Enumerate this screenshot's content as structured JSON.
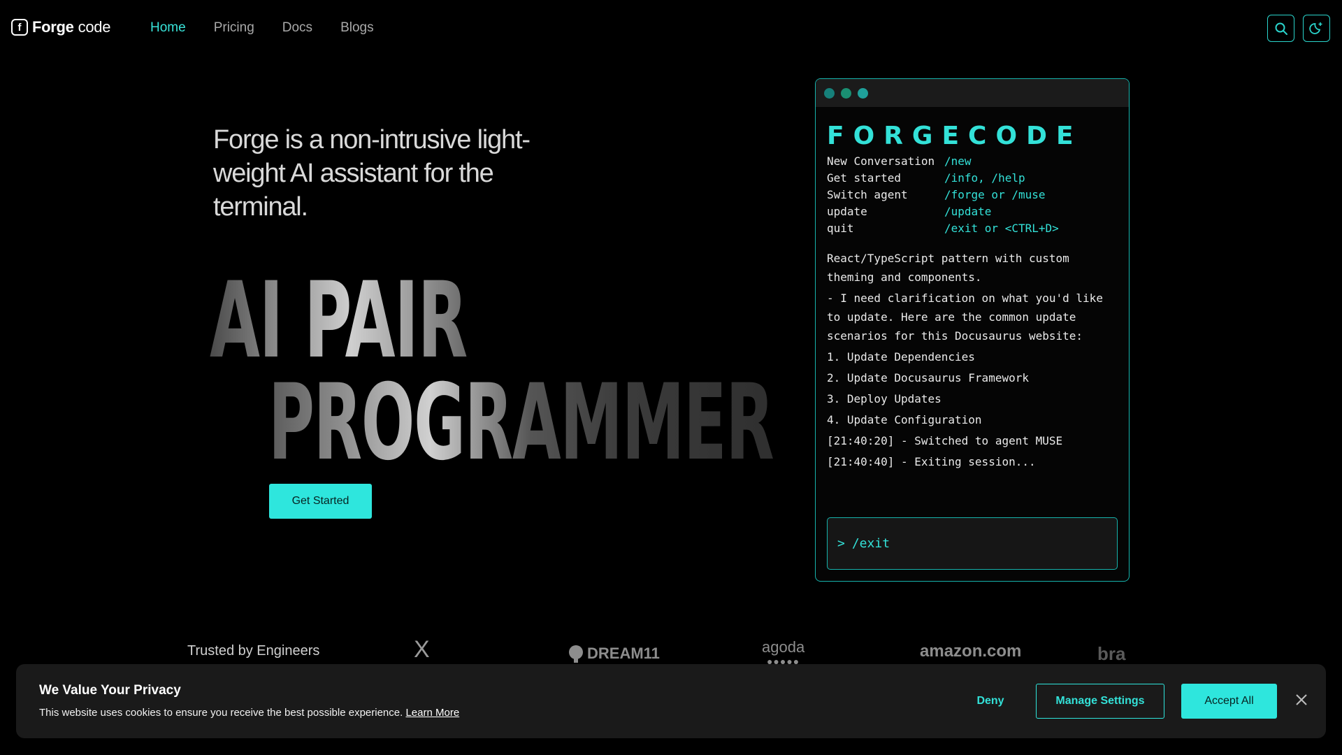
{
  "colors": {
    "accent": "#2ee6dd",
    "background": "#000000",
    "panel": "#1a1a1a"
  },
  "nav": {
    "logo_brand": "Forge",
    "logo_sub": "code",
    "links": [
      "Home",
      "Pricing",
      "Docs",
      "Blogs"
    ],
    "active": "Home",
    "icons": [
      "search-icon",
      "theme-toggle-icon"
    ]
  },
  "hero": {
    "tagline": "Forge is a non-intrusive light-weight AI assistant for the terminal.",
    "headline_line1": "AI PAIR",
    "headline_line2": "PROGRAMMER",
    "cta": "Get Started"
  },
  "terminal": {
    "title": "FORGECODE",
    "commands": [
      {
        "name": "New Conversation",
        "value": "/new"
      },
      {
        "name": "Get started",
        "value": "/info, /help"
      },
      {
        "name": "Switch agent",
        "value": "/forge or /muse"
      },
      {
        "name": "update",
        "value": "/update"
      },
      {
        "name": "quit",
        "value": "/exit or <CTRL+D>"
      }
    ],
    "messages": [
      "React/TypeScript pattern with custom theming and components.",
      "- I need clarification on what you'd like to update. Here are the common update scenarios for this Docusaurus website:",
      "1. Update Dependencies",
      "2. Update Docusaurus Framework",
      "3. Deploy Updates",
      "4. Update Configuration",
      "[21:40:20] - Switched to agent MUSE",
      "[21:40:40] - Exiting session..."
    ],
    "input_prompt": ">",
    "input_value": "/exit"
  },
  "trusted": {
    "label": "Trusted by Engineers",
    "logos": [
      "X",
      "DREAM11",
      "agoda",
      "amazon.com",
      "bra"
    ]
  },
  "cookie": {
    "title": "We Value Your Privacy",
    "text": "This website uses cookies to ensure you receive the best possible experience.",
    "link": "Learn More",
    "deny": "Deny",
    "manage": "Manage Settings",
    "accept": "Accept All"
  }
}
